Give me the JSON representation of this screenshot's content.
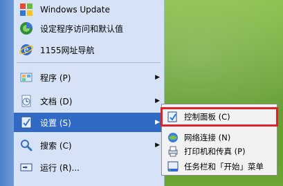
{
  "desktop": {
    "name": "desktop-background"
  },
  "start_menu": {
    "items": [
      {
        "id": "windows-update",
        "label": "Windows Update",
        "icon": "windows-update-icon"
      },
      {
        "id": "set-program-defaults",
        "label": "设定程序访问和默认值",
        "icon": "program-defaults-icon"
      },
      {
        "id": "1155-nav",
        "label": "1155网址导航",
        "icon": "internet-explorer-icon"
      },
      {
        "id": "programs",
        "label": "程序 (P)",
        "icon": "programs-folder-icon",
        "has_submenu": true
      },
      {
        "id": "documents",
        "label": "文档 (D)",
        "icon": "documents-icon",
        "has_submenu": true
      },
      {
        "id": "settings",
        "label": "设置 (S)",
        "icon": "settings-icon",
        "has_submenu": true,
        "selected": true
      },
      {
        "id": "search",
        "label": "搜索 (C)",
        "icon": "search-icon",
        "has_submenu": true
      },
      {
        "id": "run",
        "label": "运行 (R)...",
        "icon": "run-icon"
      }
    ]
  },
  "settings_submenu": {
    "items": [
      {
        "id": "control-panel",
        "label": "控制面板 (C)",
        "icon": "control-panel-icon",
        "highlighted": true
      },
      {
        "id": "network-connections",
        "label": "网络连接 (N)",
        "icon": "network-icon"
      },
      {
        "id": "printers-faxes",
        "label": "打印机和传真 (P)",
        "icon": "printer-icon"
      },
      {
        "id": "taskbar-start",
        "label": "任务栏和「开始」菜单",
        "icon": "taskbar-icon"
      }
    ]
  },
  "colors": {
    "menu_bg": "#d6e3f7",
    "selected_bg": "#316ac5",
    "highlight_outline": "#e0232b"
  }
}
